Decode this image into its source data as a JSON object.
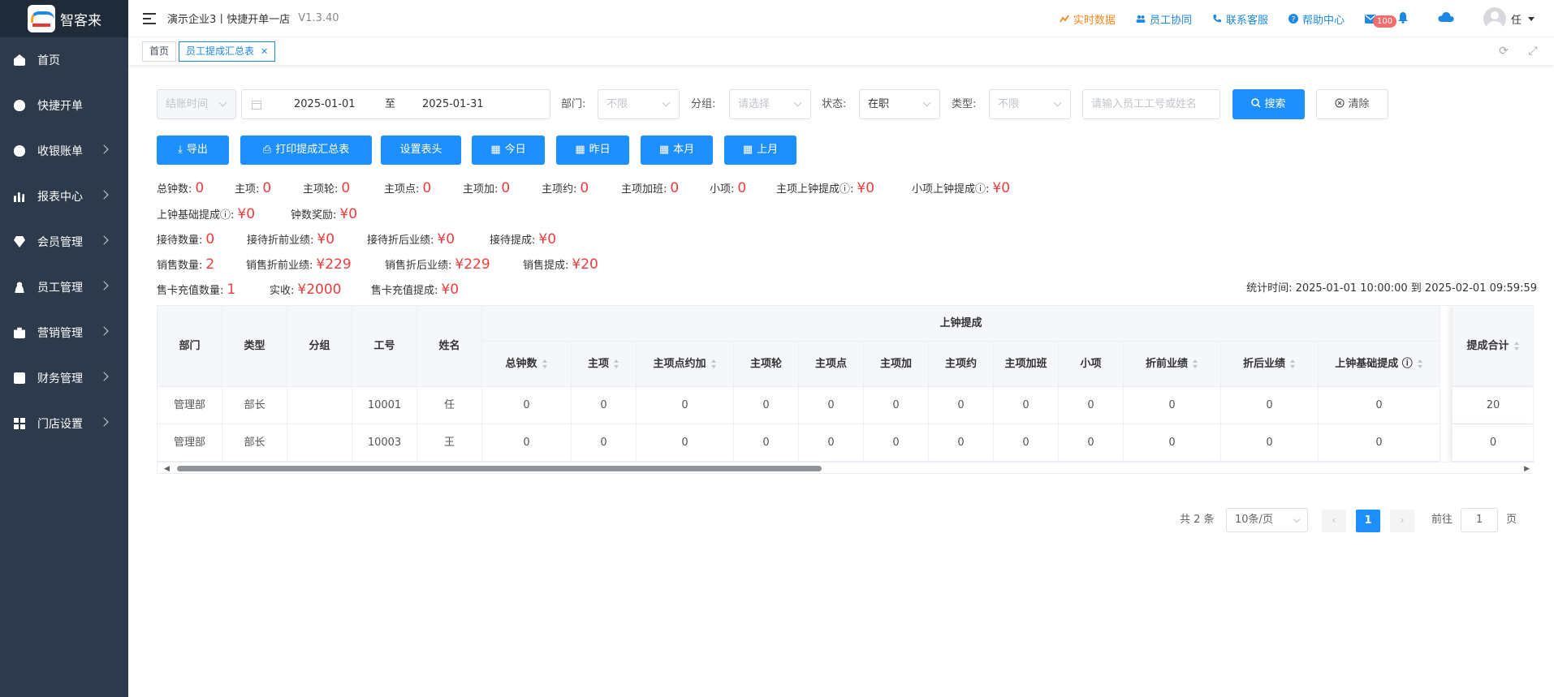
{
  "app": {
    "title": "智客来"
  },
  "sidebar": {
    "items": [
      {
        "label": "首页",
        "icon": "dashboard-icon"
      },
      {
        "label": "快捷开单",
        "icon": "bag-icon"
      },
      {
        "label": "收银账单",
        "icon": "money-bag-icon"
      },
      {
        "label": "报表中心",
        "icon": "bar-chart-icon"
      },
      {
        "label": "会员管理",
        "icon": "diamond-icon"
      },
      {
        "label": "员工管理",
        "icon": "user-icon"
      },
      {
        "label": "营销管理",
        "icon": "briefcase-icon"
      },
      {
        "label": "财务管理",
        "icon": "wallet-icon"
      },
      {
        "label": "门店设置",
        "icon": "grid-icon"
      }
    ]
  },
  "header": {
    "store": "演示企业3丨快捷开单一店",
    "version": "V1.3.40",
    "realtime": "实时数据",
    "collab": "员工协同",
    "service": "联系客服",
    "help": "帮助中心",
    "mail_badge": "100",
    "user": "任"
  },
  "tags": {
    "home": "首页",
    "current": "员工提成汇总表"
  },
  "filters": {
    "time_type_placeholder": "结账时间",
    "date_start": "2025-01-01",
    "date_sep": "至",
    "date_end": "2025-01-31",
    "dept_label": "部门:",
    "dept_value": "不限",
    "group_label": "分组:",
    "group_placeholder": "请选择",
    "status_label": "状态:",
    "status_value": "在职",
    "type_label": "类型:",
    "type_value": "不限",
    "keyword_placeholder": "请输入员工工号或姓名",
    "search": "搜索",
    "clear": "清除"
  },
  "buttons": {
    "export": "导出",
    "print": "打印提成汇总表",
    "set_header": "设置表头",
    "today": "今日",
    "yesterday": "昨日",
    "this_month": "本月",
    "last_month": "上月"
  },
  "stats": {
    "row1": [
      {
        "label": "总钟数:",
        "value": "0"
      },
      {
        "label": "主项:",
        "value": "0"
      },
      {
        "label": "主项轮:",
        "value": "0"
      },
      {
        "label": "主项点:",
        "value": "0"
      },
      {
        "label": "主项加:",
        "value": "0"
      },
      {
        "label": "主项约:",
        "value": "0"
      },
      {
        "label": "主项加班:",
        "value": "0"
      },
      {
        "label": "小项:",
        "value": "0"
      },
      {
        "label": "主项上钟提成ⓘ:",
        "value": "¥0"
      },
      {
        "label": "小项上钟提成ⓘ:",
        "value": "¥0"
      }
    ],
    "row2": [
      {
        "label": "上钟基础提成ⓘ:",
        "value": "¥0"
      },
      {
        "label": "钟数奖励:",
        "value": "¥0"
      }
    ],
    "row3": [
      {
        "label": "接待数量:",
        "value": "0"
      },
      {
        "label": "接待折前业绩:",
        "value": "¥0"
      },
      {
        "label": "接待折后业绩:",
        "value": "¥0"
      },
      {
        "label": "接待提成:",
        "value": "¥0"
      }
    ],
    "row4": [
      {
        "label": "销售数量:",
        "value": "2"
      },
      {
        "label": "销售折前业绩:",
        "value": "¥229"
      },
      {
        "label": "销售折后业绩:",
        "value": "¥229"
      },
      {
        "label": "销售提成:",
        "value": "¥20"
      }
    ],
    "row5": [
      {
        "label": "售卡充值数量:",
        "value": "1"
      },
      {
        "label": "实收:",
        "value": "¥2000"
      },
      {
        "label": "售卡充值提成:",
        "value": "¥0"
      }
    ],
    "stat_time": "统计时间: 2025-01-01 10:00:00 到 2025-02-01 09:59:59"
  },
  "table": {
    "group_header": "上钟提成",
    "columns_left": [
      "部门",
      "类型",
      "分组",
      "工号",
      "姓名"
    ],
    "columns_sub": [
      "总钟数",
      "主项",
      "主项点约加",
      "主项轮",
      "主项点",
      "主项加",
      "主项约",
      "主项加班",
      "小项",
      "折前业绩",
      "折后业绩",
      "上钟基础提成 ⓘ"
    ],
    "fixed_col": "提成合计",
    "rows": [
      {
        "dept": "管理部",
        "type": "部长",
        "group": "",
        "no": "10001",
        "name": "任",
        "vals": [
          "0",
          "0",
          "0",
          "0",
          "0",
          "0",
          "0",
          "0",
          "0",
          "0",
          "0",
          "0"
        ],
        "total": "20"
      },
      {
        "dept": "管理部",
        "type": "部长",
        "group": "",
        "no": "10003",
        "name": "王",
        "vals": [
          "0",
          "0",
          "0",
          "0",
          "0",
          "0",
          "0",
          "0",
          "0",
          "0",
          "0",
          "0"
        ],
        "total": "0"
      }
    ]
  },
  "pagination": {
    "total": "共 2 条",
    "page_size": "10条/页",
    "current": "1",
    "goto_label": "前往",
    "goto_value": "1",
    "page_unit": "页"
  }
}
